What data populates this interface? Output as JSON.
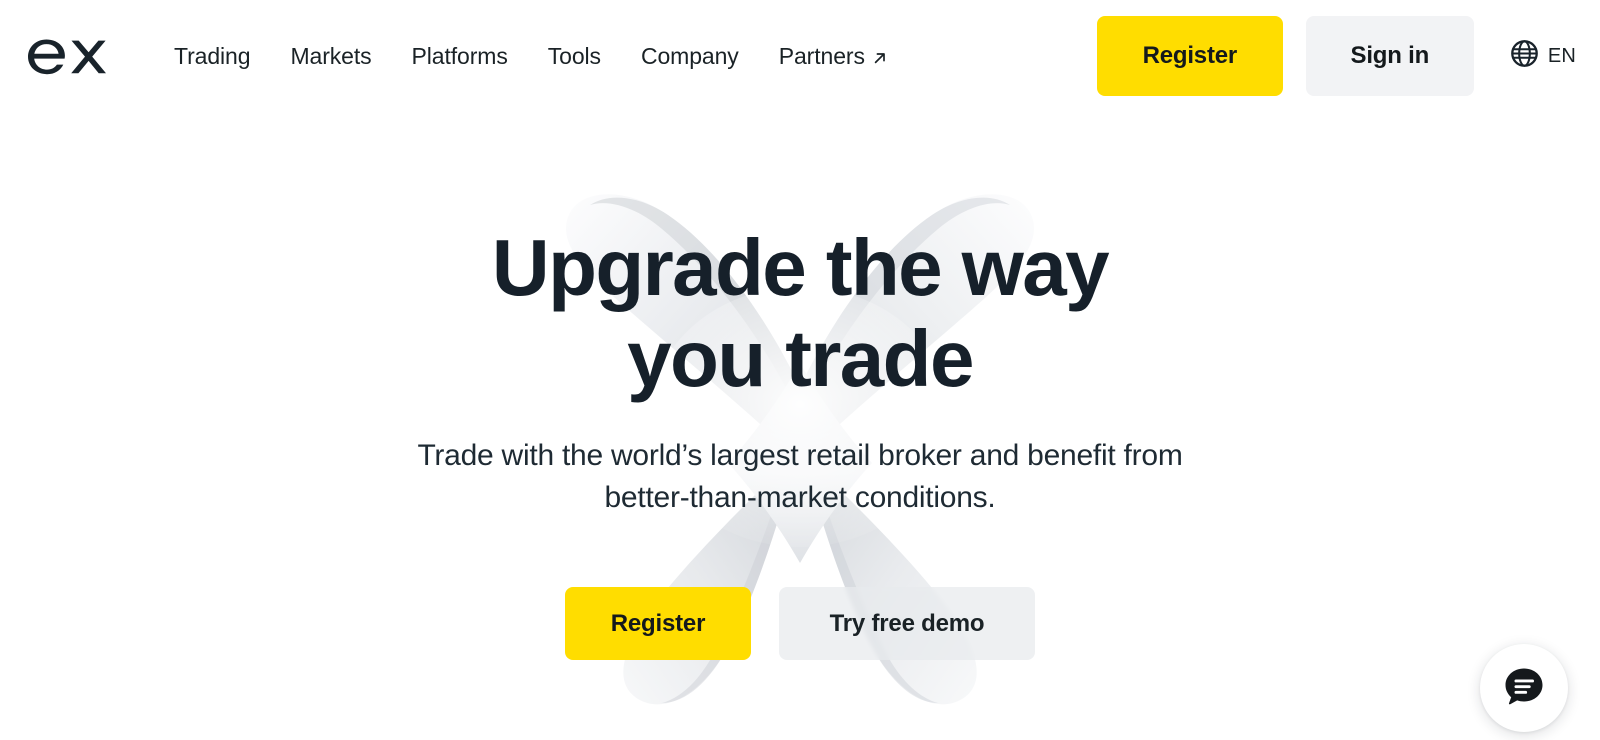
{
  "brand": {
    "logo_text": "ex",
    "logo_icon": "exness-logo"
  },
  "header": {
    "nav": [
      {
        "label": "Trading",
        "icon": null
      },
      {
        "label": "Markets",
        "icon": null
      },
      {
        "label": "Platforms",
        "icon": null
      },
      {
        "label": "Tools",
        "icon": null
      },
      {
        "label": "Company",
        "icon": null
      },
      {
        "label": "Partners",
        "icon": "external-link-arrow-icon"
      }
    ],
    "register_label": "Register",
    "signin_label": "Sign in",
    "language": {
      "icon": "globe-icon",
      "code": "EN"
    }
  },
  "hero": {
    "title_line1": "Upgrade the way",
    "title_line2": "you trade",
    "subtitle": "Trade with the world’s largest retail broker and benefit from better-than-market conditions.",
    "primary_cta": "Register",
    "secondary_cta": "Try free demo",
    "background_art": "3d-white-ribbon-knot"
  },
  "chat": {
    "icon": "chat-bubble-icon",
    "aria_label": "Open chat"
  },
  "colors": {
    "accent_yellow": "#FFDD00",
    "text_dark": "#16202A",
    "button_gray": "#F2F3F5",
    "page_background": "#FFFFFF"
  }
}
